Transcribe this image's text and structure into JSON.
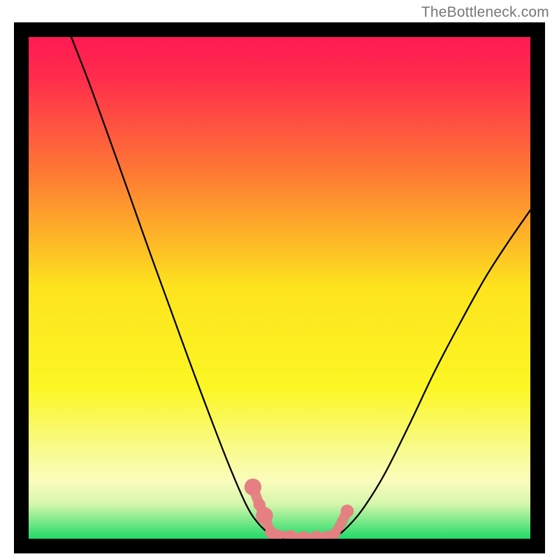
{
  "attribution": "TheBottleneck.com",
  "chart_data": {
    "type": "line",
    "title": "",
    "xlabel": "",
    "ylabel": "",
    "xlim": [
      0,
      1
    ],
    "ylim": [
      0,
      1
    ],
    "background_gradient": {
      "stops": [
        {
          "offset": 0.0,
          "color": "#ff1a52"
        },
        {
          "offset": 0.08,
          "color": "#ff2c4c"
        },
        {
          "offset": 0.28,
          "color": "#fe7d33"
        },
        {
          "offset": 0.5,
          "color": "#fde41e"
        },
        {
          "offset": 0.7,
          "color": "#fcf624"
        },
        {
          "offset": 0.82,
          "color": "#f8fb8a"
        },
        {
          "offset": 0.885,
          "color": "#fafcbc"
        },
        {
          "offset": 0.93,
          "color": "#d7f6ad"
        },
        {
          "offset": 0.965,
          "color": "#7be989"
        },
        {
          "offset": 1.0,
          "color": "#20da6a"
        }
      ]
    },
    "curve_left": {
      "note": "steep descending branch from top-left",
      "x": [
        0.085,
        0.12,
        0.16,
        0.2,
        0.24,
        0.28,
        0.32,
        0.36,
        0.4,
        0.435,
        0.46,
        0.485
      ],
      "y": [
        1.0,
        0.91,
        0.8,
        0.688,
        0.575,
        0.465,
        0.355,
        0.248,
        0.145,
        0.065,
        0.028,
        0.005
      ]
    },
    "curve_right": {
      "note": "gentler ascending branch toward top-right",
      "x": [
        0.615,
        0.64,
        0.67,
        0.71,
        0.76,
        0.81,
        0.86,
        0.91,
        0.955,
        1.0
      ],
      "y": [
        0.005,
        0.028,
        0.065,
        0.13,
        0.23,
        0.335,
        0.43,
        0.52,
        0.59,
        0.655
      ]
    },
    "flat_bottom": {
      "x": [
        0.485,
        0.5,
        0.53,
        0.56,
        0.59,
        0.615
      ],
      "y": [
        0.005,
        0.0,
        0.0,
        0.0,
        0.0,
        0.005
      ]
    },
    "markers": [
      {
        "x": 0.447,
        "y": 0.103,
        "r": 0.017
      },
      {
        "x": 0.46,
        "y": 0.068,
        "r": 0.012
      },
      {
        "x": 0.47,
        "y": 0.046,
        "r": 0.017
      },
      {
        "x": 0.483,
        "y": 0.013,
        "r": 0.012
      },
      {
        "x": 0.498,
        "y": 0.007,
        "r": 0.011
      },
      {
        "x": 0.522,
        "y": 0.003,
        "r": 0.014
      },
      {
        "x": 0.548,
        "y": 0.001,
        "r": 0.014
      },
      {
        "x": 0.574,
        "y": 0.002,
        "r": 0.014
      },
      {
        "x": 0.597,
        "y": 0.004,
        "r": 0.012
      },
      {
        "x": 0.612,
        "y": 0.012,
        "r": 0.01
      },
      {
        "x": 0.635,
        "y": 0.055,
        "r": 0.013
      }
    ],
    "marker_color": "#e67f82",
    "curve_color": "#000000"
  }
}
